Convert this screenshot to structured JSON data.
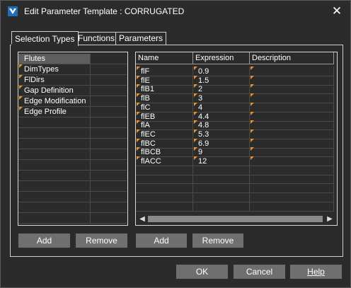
{
  "window": {
    "title": "Edit Parameter Template : CORRUGATED"
  },
  "tabs": [
    {
      "label": "Selection Types"
    },
    {
      "label": "Functions"
    },
    {
      "label": "Parameters"
    }
  ],
  "selection_types": {
    "items": [
      {
        "label": "Flutes",
        "selected": true
      },
      {
        "label": "DimTypes"
      },
      {
        "label": "FlDirs"
      },
      {
        "label": "Gap Definition"
      },
      {
        "label": "Edge Modification"
      },
      {
        "label": "Edge Profile"
      }
    ],
    "add_label": "Add",
    "remove_label": "Remove"
  },
  "parameters_table": {
    "columns": [
      "Name",
      "Expression",
      "Description"
    ],
    "rows": [
      {
        "name": "flF",
        "expression": "0.9",
        "description": ""
      },
      {
        "name": "flE",
        "expression": "1.5",
        "description": ""
      },
      {
        "name": "flB1",
        "expression": "2",
        "description": ""
      },
      {
        "name": "flB",
        "expression": "3",
        "description": ""
      },
      {
        "name": "flC",
        "expression": "4",
        "description": ""
      },
      {
        "name": "flEB",
        "expression": "4.4",
        "description": ""
      },
      {
        "name": "flA",
        "expression": "4.8",
        "description": ""
      },
      {
        "name": "flEC",
        "expression": "5.3",
        "description": ""
      },
      {
        "name": "flBC",
        "expression": "6.9",
        "description": ""
      },
      {
        "name": "flBCB",
        "expression": "9",
        "description": ""
      },
      {
        "name": "flACC",
        "expression": "12",
        "description": ""
      }
    ],
    "add_label": "Add",
    "remove_label": "Remove"
  },
  "footer": {
    "ok_label": "OK",
    "cancel_label": "Cancel",
    "help_label": "Help"
  },
  "colors": {
    "background": "#2b2b2b",
    "button": "#6f6f6f",
    "selected_row": "#5e5e5e",
    "marker_orange": "#e8902e",
    "marker_blue": "#2d8fe0"
  }
}
